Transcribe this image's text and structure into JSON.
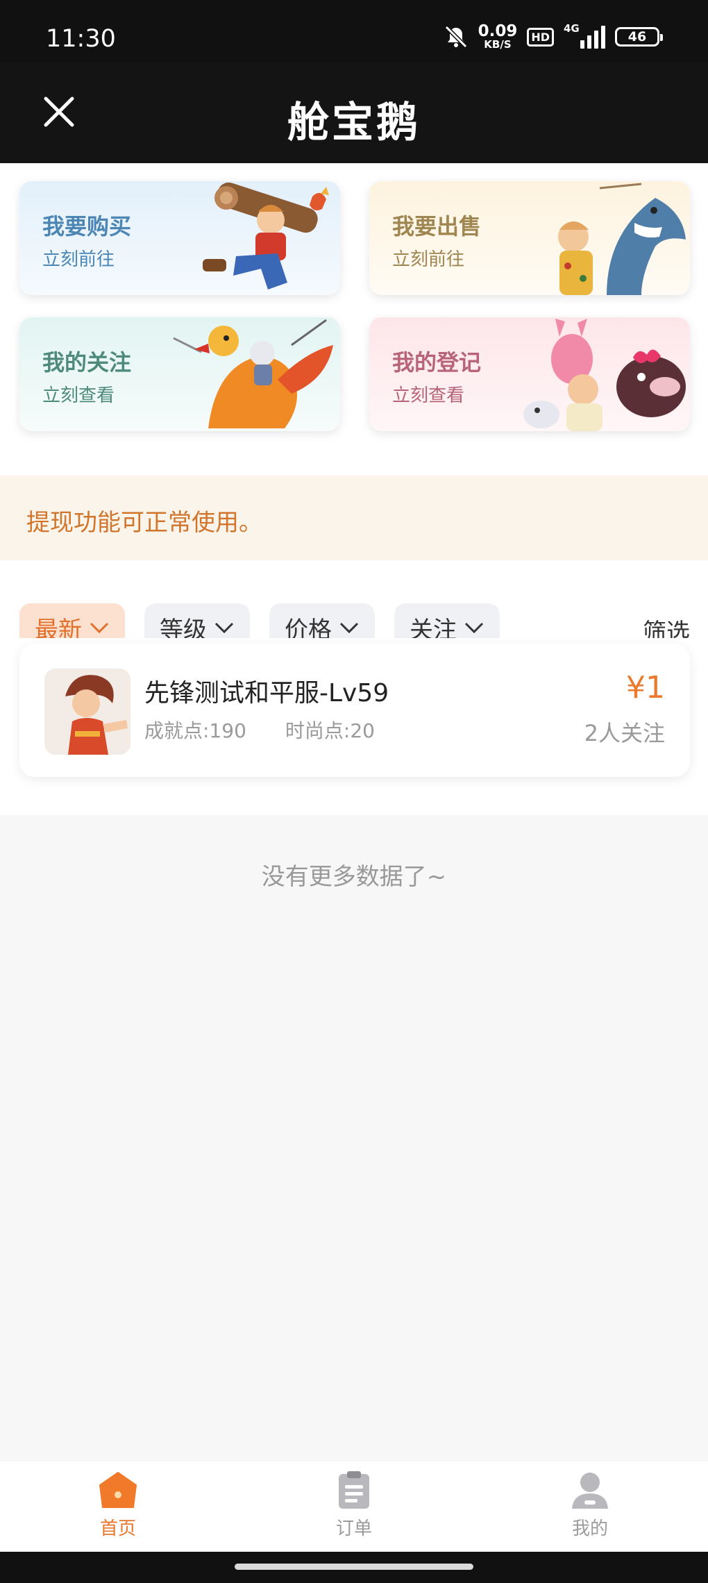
{
  "status_bar": {
    "time": "11:30",
    "net_speed_value": "0.09",
    "net_speed_unit": "KB/S",
    "hd_label": "HD",
    "network_type": "4G",
    "battery": "46"
  },
  "header": {
    "title": "舱宝鹅",
    "close_icon": "close-icon"
  },
  "entry_cards": [
    {
      "title": "我要购买",
      "subtitle": "立刻前往",
      "color": "#4b86b5"
    },
    {
      "title": "我要出售",
      "subtitle": "立刻前往",
      "color": "#9f8550"
    },
    {
      "title": "我的关注",
      "subtitle": "立刻查看",
      "color": "#4e8a7a"
    },
    {
      "title": "我的登记",
      "subtitle": "立刻查看",
      "color": "#b86478"
    }
  ],
  "notice": {
    "text": "提现功能可正常使用。"
  },
  "filters": {
    "chips": [
      {
        "label": "最新",
        "active": true
      },
      {
        "label": "等级",
        "active": false
      },
      {
        "label": "价格",
        "active": false
      },
      {
        "label": "关注",
        "active": false
      }
    ],
    "filter_label": "筛选"
  },
  "listings": [
    {
      "name": "先锋测试和平服-Lv59",
      "achievement": "成就点:190",
      "fashion": "时尚点:20",
      "price": "¥1",
      "followers": "2人关注"
    }
  ],
  "no_more_text": "没有更多数据了~",
  "tabbar": {
    "items": [
      {
        "label": "首页",
        "icon": "home-icon",
        "active": true
      },
      {
        "label": "订单",
        "icon": "order-icon",
        "active": false
      },
      {
        "label": "我的",
        "icon": "profile-icon",
        "active": false
      }
    ]
  },
  "colors": {
    "accent": "#e8772e",
    "price": "#ec7a2c",
    "notice_bg": "#fbf4ea",
    "header_bg": "#141414"
  }
}
